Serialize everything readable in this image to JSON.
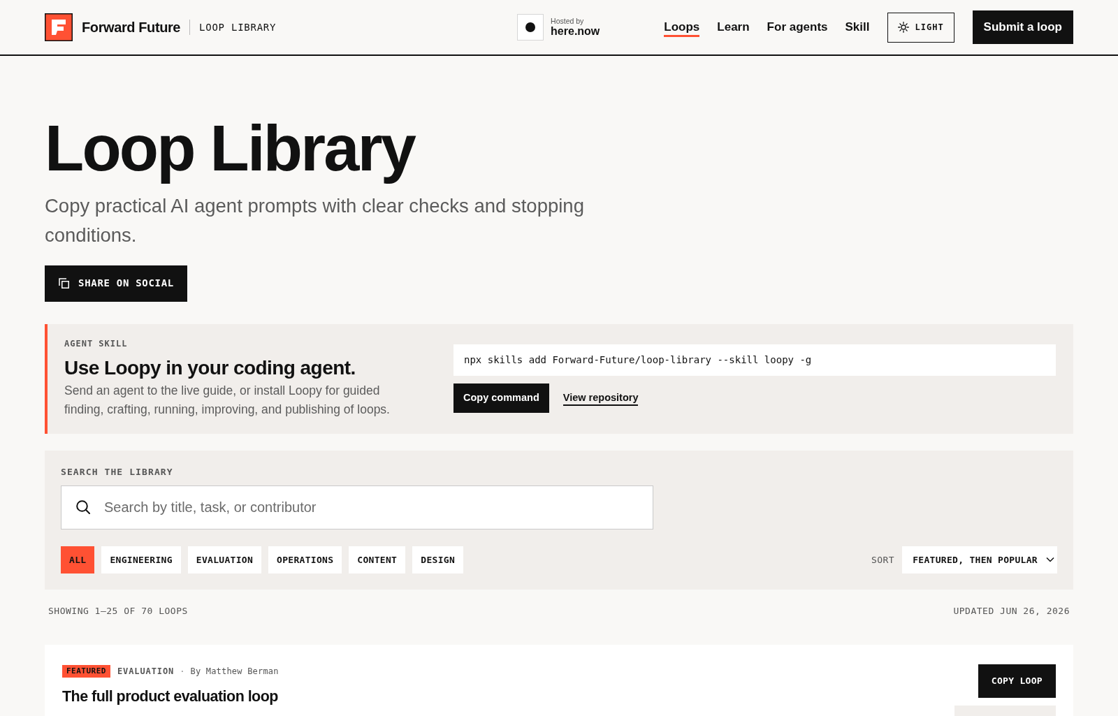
{
  "header": {
    "brand": "Forward Future",
    "section": "LOOP LIBRARY",
    "host": {
      "caption": "Hosted by",
      "name": "here.now"
    },
    "nav": [
      {
        "label": "Loops",
        "selected": true
      },
      {
        "label": "Learn",
        "selected": false
      },
      {
        "label": "For agents",
        "selected": false
      },
      {
        "label": "Skill",
        "selected": false
      }
    ],
    "theme_button": "LIGHT",
    "submit_button": "Submit a loop"
  },
  "hero": {
    "title": "Loop Library",
    "subtitle": "Copy practical AI agent prompts with clear checks and stopping conditions.",
    "share_button": "SHARE ON SOCIAL"
  },
  "agent_skill": {
    "eyebrow": "AGENT SKILL",
    "title": "Use Loopy in your coding agent.",
    "description": "Send an agent to the live guide, or install Loopy for guided finding, crafting, running, improving, and publishing of loops.",
    "command": "npx skills add Forward-Future/loop-library --skill loopy -g",
    "copy_button": "Copy command",
    "repository_link": "View repository"
  },
  "search": {
    "label": "SEARCH THE LIBRARY",
    "placeholder": "Search by title, task, or contributor",
    "filters": [
      {
        "label": "ALL",
        "selected": true
      },
      {
        "label": "ENGINEERING",
        "selected": false
      },
      {
        "label": "EVALUATION",
        "selected": false
      },
      {
        "label": "OPERATIONS",
        "selected": false
      },
      {
        "label": "CONTENT",
        "selected": false
      },
      {
        "label": "DESIGN",
        "selected": false
      }
    ],
    "sort": {
      "label": "SORT",
      "value": "FEATURED, THEN POPULAR"
    }
  },
  "results": {
    "showing": "SHOWING 1–25 OF 70 LOOPS",
    "updated": "UPDATED JUN 26, 2026"
  },
  "loops": [
    {
      "badge": "FEATURED",
      "category": "EVALUATION",
      "separator": "·",
      "author": "By Matthew Berman",
      "title": "The full product evaluation loop",
      "copy_button": "COPY LOOP"
    }
  ]
}
